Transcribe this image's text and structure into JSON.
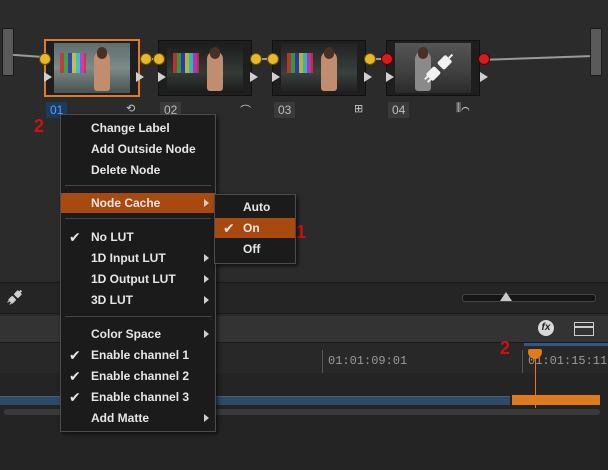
{
  "node_editor": {
    "nodes": [
      {
        "label": "01",
        "tool_icon": "",
        "selected": true
      },
      {
        "label": "02",
        "tool_icon": "⟲"
      },
      {
        "label": "03",
        "tool_icon": "⌒"
      },
      {
        "label": "04",
        "tool_icon": "⊞"
      }
    ],
    "node4_extra_icon": "⫼⌒",
    "annotations": {
      "marker_1": "1",
      "marker_2_nodes": "2",
      "marker_2_timeline": "2"
    }
  },
  "context_menu": {
    "items": [
      {
        "label": "Change Label"
      },
      {
        "label": "Add Outside Node"
      },
      {
        "label": "Delete Node"
      },
      {
        "label": "Node Cache",
        "submenu": true,
        "highlighted": true
      },
      {
        "label": "No LUT",
        "checked": true
      },
      {
        "label": "1D Input LUT",
        "submenu": true
      },
      {
        "label": "1D Output LUT",
        "submenu": true
      },
      {
        "label": "3D LUT",
        "submenu": true
      },
      {
        "label": "Color Space",
        "submenu": true
      },
      {
        "label": "Enable channel 1",
        "checked": true
      },
      {
        "label": "Enable channel 2",
        "checked": true
      },
      {
        "label": "Enable channel 3",
        "checked": true
      },
      {
        "label": "Add Matte",
        "submenu": true
      }
    ],
    "check_glyph": "✔"
  },
  "node_cache_submenu": {
    "items": [
      {
        "label": "Auto"
      },
      {
        "label": "On",
        "checked": true,
        "highlighted": true
      },
      {
        "label": "Off"
      }
    ]
  },
  "timeline": {
    "timecodes": [
      "01:01:09:01",
      "01:01:15:11"
    ],
    "fx_label": "fx"
  },
  "colors": {
    "accent_orange": "#e07a2c",
    "menu_highlight": "#a84a10",
    "marker_red": "#d01010",
    "node_port_yellow": "#e9b82a",
    "node_port_red": "#d61c1c"
  }
}
